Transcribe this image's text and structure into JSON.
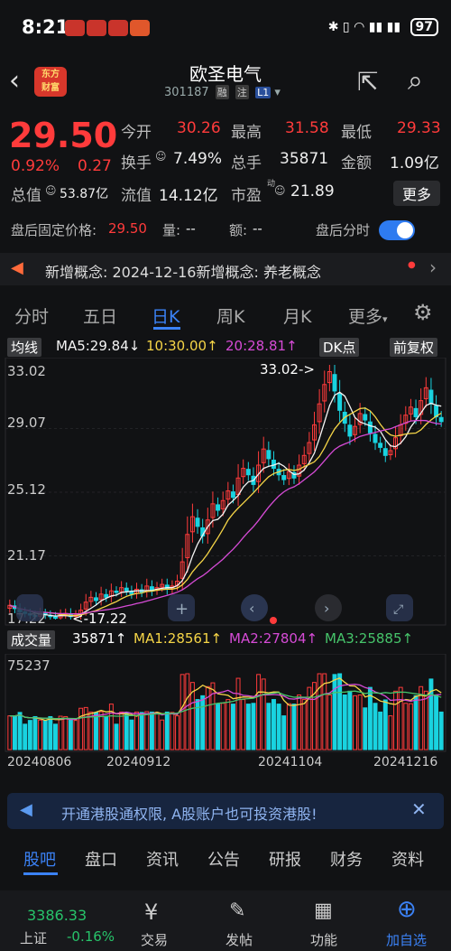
{
  "status_bar": {
    "time": "8:21",
    "battery": "97"
  },
  "header": {
    "logo_line1": "东方",
    "logo_line2": "财富",
    "title": "欧圣电气",
    "code": "301187",
    "tag_margin": "融",
    "tag_note": "注",
    "tag_level": "L1"
  },
  "quote": {
    "price": "29.50",
    "change_pct": "0.92%",
    "change": "0.27",
    "open_label": "今开",
    "open": "30.26",
    "high_label": "最高",
    "high": "31.58",
    "low_label": "最低",
    "low": "29.33",
    "turnover_label": "换手",
    "turnover": "7.49%",
    "volume_label": "总手",
    "volume": "35871",
    "amount_label": "金额",
    "amount": "1.09亿",
    "total_cap_label": "总值",
    "total_cap": "53.87亿",
    "float_cap_label": "流值",
    "float_cap": "14.12亿",
    "pe_label": "市盈",
    "pe_sup": "动",
    "pe": "21.89",
    "more": "更多"
  },
  "after_hours": {
    "price_label": "盘后固定价格:",
    "price": "29.50",
    "vol_label": "量:",
    "vol": "--",
    "amt_label": "额:",
    "amt": "--",
    "timeshare_label": "盘后分时"
  },
  "concept": {
    "text": "新增概念:  2024-12-16新增概念:  养老概念"
  },
  "tabs": {
    "t1": "分时",
    "t2": "五日",
    "t3": "日K",
    "t4": "周K",
    "t5": "月K",
    "t6": "更多"
  },
  "kline_bar": {
    "ma_label": "均线",
    "ma5": "MA5:29.84↓",
    "ma10": "10:30.00↑",
    "ma20": "20:28.81↑",
    "dk": "DK点",
    "adj": "前复权"
  },
  "chart_data": {
    "type": "candlestick",
    "y_ticks": [
      "33.02",
      "29.07",
      "25.12",
      "21.17",
      "17.22"
    ],
    "ylim": [
      17.22,
      33.02
    ],
    "max_annotation": "33.02->",
    "min_annotation": "<-17.22",
    "x_ticks": [
      "20240806",
      "20240912",
      "20241104",
      "20241216"
    ],
    "colors": {
      "up": "#ff3b3b",
      "down": "#19d3e0",
      "ma5": "#f4f4f4",
      "ma10": "#f5d547",
      "ma20": "#d64bd6"
    },
    "closes": [
      18.1,
      17.9,
      17.7,
      17.6,
      17.5,
      17.4,
      17.6,
      17.5,
      17.4,
      17.3,
      17.5,
      17.6,
      17.4,
      17.5,
      17.8,
      18.3,
      18.6,
      18.4,
      18.8,
      18.6,
      19.0,
      18.9,
      19.2,
      19.0,
      18.8,
      19.1,
      18.9,
      19.3,
      19.0,
      19.2,
      19.4,
      19.1,
      19.3,
      19.6,
      20.8,
      22.5,
      23.6,
      23.0,
      22.4,
      23.4,
      24.4,
      24.0,
      24.6,
      25.2,
      24.8,
      26.0,
      26.6,
      26.2,
      25.6,
      26.8,
      27.8,
      27.2,
      26.6,
      26.2,
      25.9,
      26.4,
      26.0,
      26.8,
      27.4,
      28.2,
      29.3,
      30.6,
      31.8,
      32.6,
      31.4,
      30.2,
      29.4,
      28.6,
      29.2,
      30.0,
      29.6,
      28.8,
      28.2,
      27.9,
      27.4,
      27.7,
      28.5,
      29.3,
      29.9,
      30.4,
      29.8,
      30.8,
      31.6,
      30.6,
      29.8,
      29.5
    ],
    "volume_series": {
      "label": "成交量",
      "value": "35871↑",
      "ma1": "MA1:28561↑",
      "ma2": "MA2:27804↑",
      "ma3": "MA3:25885↑",
      "max_tick": "75237"
    }
  },
  "banner": {
    "text": "开通港股通权限, A股账户也可投资港股!"
  },
  "sub_tabs": {
    "s1": "股吧",
    "s2": "盘口",
    "s3": "资讯",
    "s4": "公告",
    "s5": "研报",
    "s6": "财务",
    "s7": "资料"
  },
  "bottom_bar": {
    "index_value": "3386.33",
    "index_name": "上证",
    "index_change": "-0.16%",
    "trade": "交易",
    "post": "发帖",
    "func": "功能",
    "add": "加自选"
  }
}
